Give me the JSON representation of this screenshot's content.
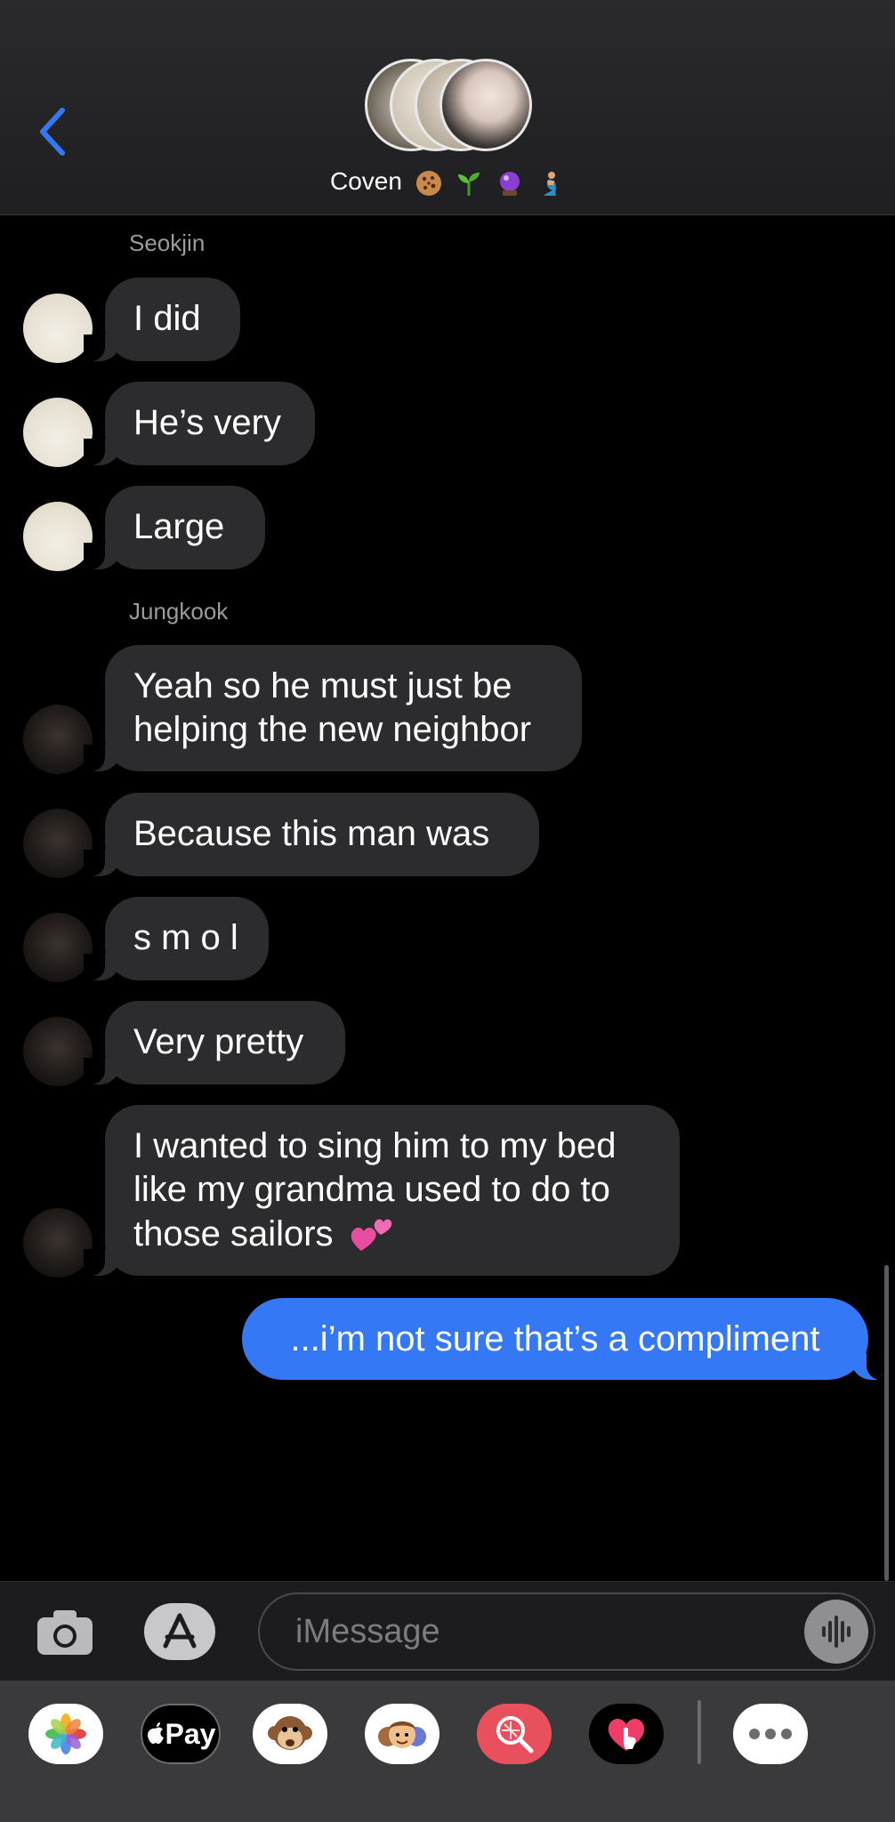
{
  "header": {
    "group_name": "Coven",
    "title_emoji_icons": [
      "cookie-icon",
      "seedling-icon",
      "crystal-ball-icon",
      "merperson-icon"
    ]
  },
  "senders": {
    "first": "Seokjin",
    "second": "Jungkook"
  },
  "messages": [
    {
      "sender": "Seokjin",
      "lines": [
        "I did"
      ]
    },
    {
      "sender": "Seokjin",
      "lines": [
        "He’s very"
      ]
    },
    {
      "sender": "Seokjin",
      "lines": [
        "Large"
      ]
    },
    {
      "sender": "Jungkook",
      "lines": [
        "Yeah so he must just be",
        "helping the new neighbor"
      ]
    },
    {
      "sender": "Jungkook",
      "lines": [
        "Because this man was"
      ]
    },
    {
      "sender": "Jungkook",
      "lines": [
        "s m o l"
      ]
    },
    {
      "sender": "Jungkook",
      "lines": [
        "Very pretty"
      ]
    },
    {
      "sender": "Jungkook",
      "lines": [
        "I wanted to sing him to my bed",
        "like my grandma used to do to",
        "those sailors"
      ]
    }
  ],
  "outgoing": {
    "text": "...i’m not sure that’s a compliment"
  },
  "input": {
    "placeholder": "iMessage"
  },
  "drawer": {
    "apple_pay_label": "Pay",
    "apps": [
      "photos-icon",
      "apple-pay-icon",
      "monkey-icon",
      "memoji-icon",
      "image-search-icon",
      "digital-touch-icon",
      "more-icon"
    ]
  },
  "colors": {
    "accent": "#3478f6",
    "incoming_bubble": "#2c2c2e",
    "background": "#000000"
  }
}
